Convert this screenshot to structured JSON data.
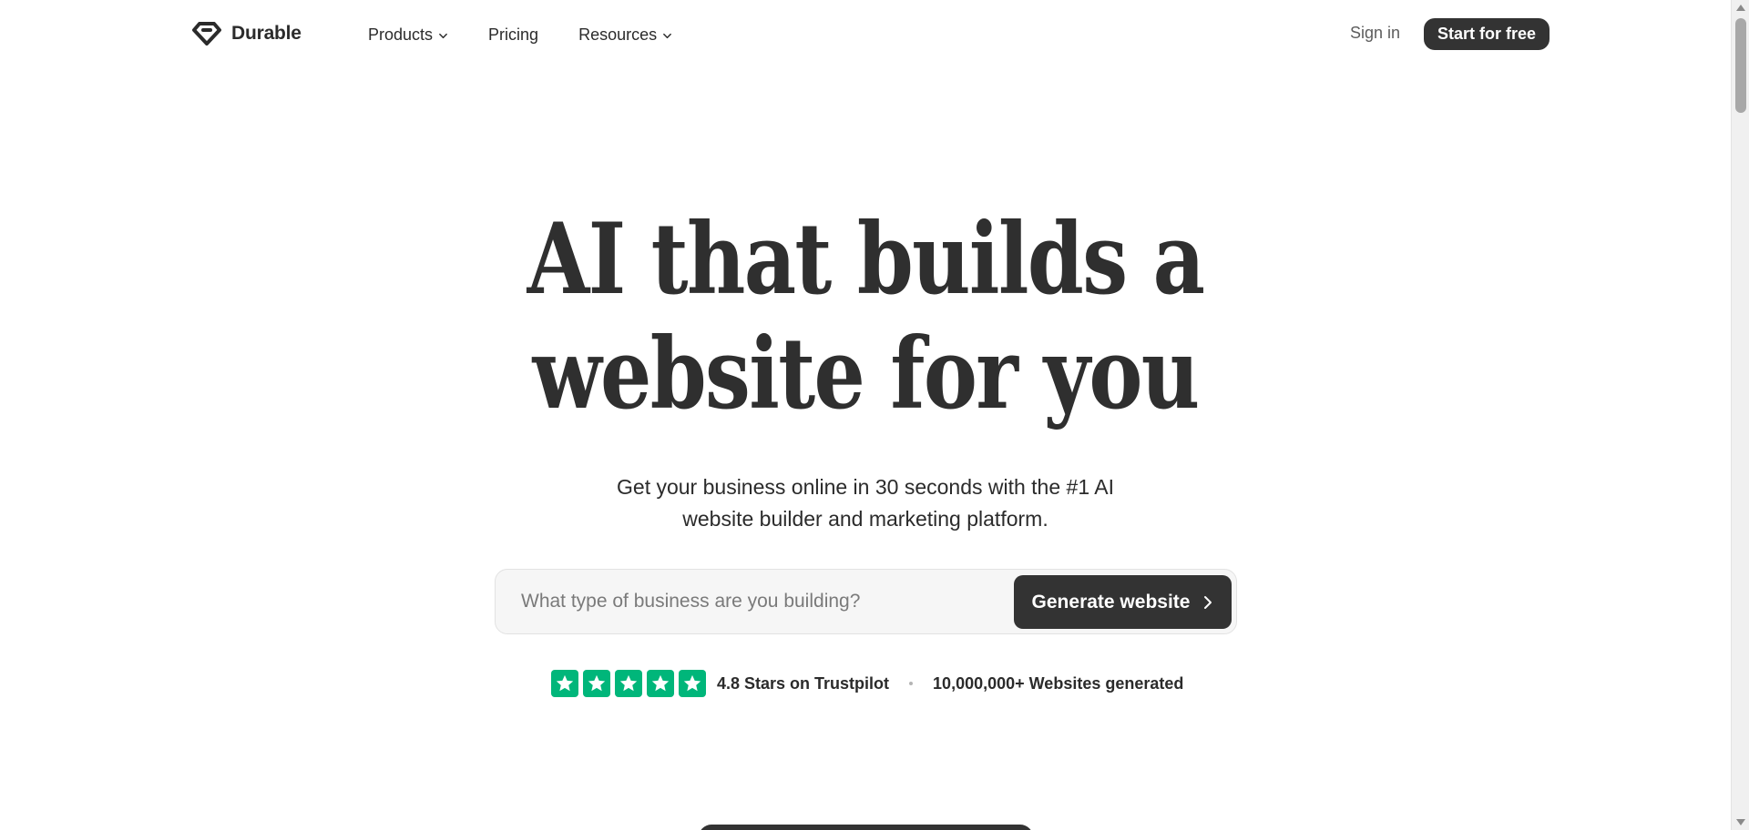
{
  "brand": {
    "name": "Durable",
    "logo_icon": "diamond-logo-icon"
  },
  "nav": {
    "items": [
      {
        "label": "Products",
        "has_dropdown": true
      },
      {
        "label": "Pricing",
        "has_dropdown": false
      },
      {
        "label": "Resources",
        "has_dropdown": true
      }
    ],
    "sign_in": "Sign in",
    "cta": "Start for free"
  },
  "hero": {
    "title_line1": "AI that builds a",
    "title_line2": "website for you",
    "subtitle_line1": "Get your business online in 30 seconds with the #1 AI",
    "subtitle_line2": "website builder and marketing platform."
  },
  "generator": {
    "placeholder": "What type of business are you building?",
    "value": "",
    "button_label": "Generate website",
    "button_icon": "chevron-right-icon"
  },
  "trust": {
    "stars": 5,
    "rating_text": "4.8 Stars on Trustpilot",
    "sites_text": "10,000,000+ Websites generated",
    "star_color": "#00b67a"
  },
  "colors": {
    "accent": "#333333",
    "text": "#2b2b2b",
    "muted": "#5d5d5d"
  }
}
